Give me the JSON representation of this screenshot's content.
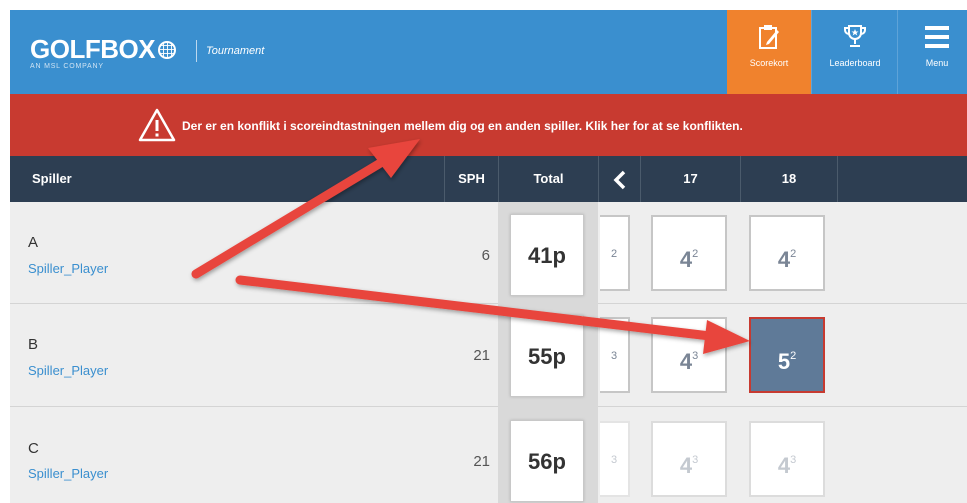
{
  "brand": {
    "logo_text": "GOLFBOX",
    "tagline": "AN MSL COMPANY",
    "section": "Tournament"
  },
  "nav": {
    "scorekort": "Scorekort",
    "leaderboard": "Leaderboard",
    "menu": "Menu"
  },
  "alert": {
    "message": "Der er en konflikt i scoreindtastningen mellem dig og en anden spiller. Klik her for at se konflikten."
  },
  "table": {
    "headers": {
      "player": "Spiller",
      "sph": "SPH",
      "total": "Total",
      "prev": "<",
      "hole17": "17",
      "hole18": "18"
    },
    "rows": [
      {
        "name": "A",
        "link": "Spiller_Player",
        "sph": "6",
        "total": "41p",
        "hole16_partial": "2",
        "h17": "4",
        "h17_sup": "2",
        "h18": "4",
        "h18_sup": "2"
      },
      {
        "name": "B",
        "link": "Spiller_Player",
        "sph": "21",
        "total": "55p",
        "hole16_partial": "3",
        "h17": "4",
        "h17_sup": "3",
        "h18": "5",
        "h18_sup": "2"
      },
      {
        "name": "C",
        "link": "Spiller_Player",
        "sph": "21",
        "total": "56p",
        "hole16_partial": "3",
        "h17": "4",
        "h17_sup": "3",
        "h18": "4",
        "h18_sup": "3"
      }
    ]
  },
  "colors": {
    "header_blue": "#3a8fcf",
    "scorekort_orange": "#f0822d",
    "alert_red": "#c83a30",
    "table_header": "#2d3e52",
    "active_cell": "#5f7a98",
    "annotation_arrow": "#e8453c"
  }
}
